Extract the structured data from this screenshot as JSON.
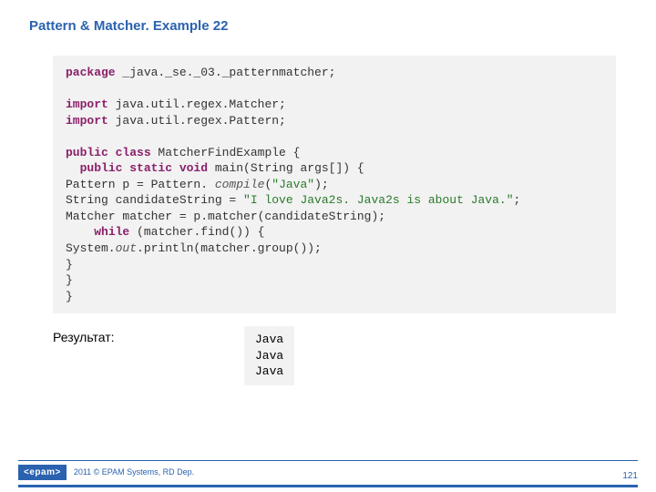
{
  "title": "Pattern & Matcher. Example 22",
  "code": {
    "package_line": {
      "kw": "package",
      "rest": " _java._se._03._patternmatcher;"
    },
    "import1": {
      "kw": "import",
      "rest": " java.util.regex.Matcher;"
    },
    "import2": {
      "kw": "import",
      "rest": " java.util.regex.Pattern;"
    },
    "class_decl": {
      "kw": "public class",
      "rest": " MatcherFindExample {"
    },
    "main_decl": {
      "kw": "public static void",
      "rest": " main(String args[]) {"
    },
    "l1_a": "    Pattern p = Pattern.",
    "l1_it": " compile",
    "l1_b": "(",
    "l1_str": "\"Java\"",
    "l1_c": ");",
    "l2_a": "    String candidateString = ",
    "l2_str": "\"I love Java2s. Java2s is about Java.\"",
    "l2_c": ";",
    "l3": "    Matcher matcher = p.matcher(candidateString);",
    "l4_kw": "while",
    "l4_b": " (matcher.find()) {",
    "l5_a": "    System.",
    "l5_it": "out",
    "l5_b": ".println(matcher.group());",
    "cb1": "    }",
    "cb2": "  }",
    "cb3": "}"
  },
  "result_label": "Результат:",
  "output": "Java\nJava\nJava",
  "footer": {
    "logo": "<epam>",
    "text": "2011 © EPAM Systems, RD Dep."
  },
  "page_number": "121"
}
